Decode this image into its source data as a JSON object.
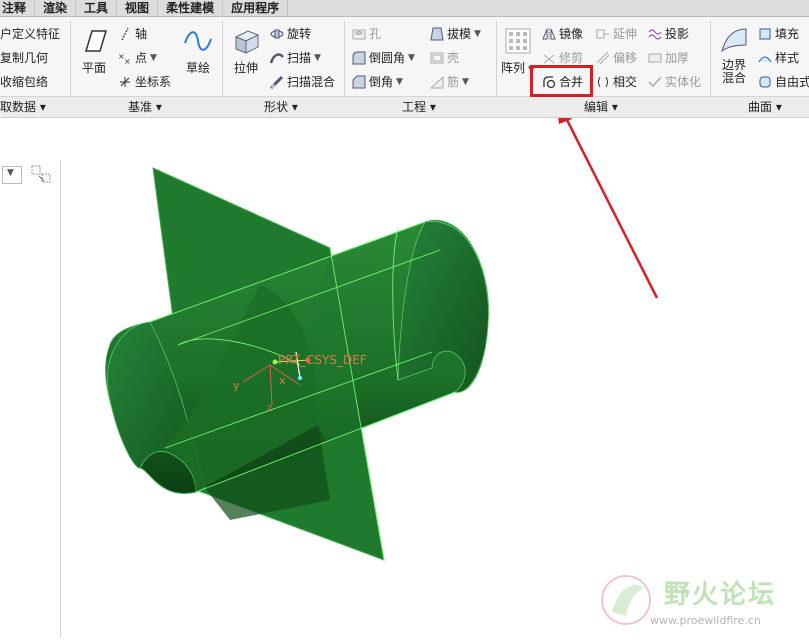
{
  "tabs": [
    "注释",
    "渲染",
    "工具",
    "视图",
    "柔性建模",
    "应用程序"
  ],
  "groups": {
    "get_data": {
      "label": "取数据",
      "items": [
        "户定义特征",
        "复制几何",
        "收缩包络"
      ]
    },
    "datum": {
      "label": "基准",
      "plane": "平面",
      "axis": "轴",
      "point": "点",
      "csys": "坐标系",
      "sketch": "草绘"
    },
    "shapes": {
      "label": "形状",
      "extrude": "拉伸",
      "revolve": "旋转",
      "sweep": "扫描",
      "swept_blend": "扫描混合"
    },
    "engineering": {
      "label": "工程",
      "hole": "孔",
      "round": "倒圆角",
      "chamfer": "倒角",
      "draft": "拔模",
      "shell": "壳",
      "rib": "筋"
    },
    "editing": {
      "label": "编辑",
      "pattern": "阵列",
      "mirror": "镜像",
      "trim": "修剪",
      "merge": "合并",
      "extend": "延伸",
      "offset": "偏移",
      "intersect": "相交",
      "project": "投影",
      "thicken": "加厚",
      "solidify": "实体化"
    },
    "surfaces": {
      "label": "曲面",
      "boundary_blend_line1": "边界",
      "boundary_blend_line2": "混合",
      "fill": "填充",
      "style": "样式",
      "freestyle": "自由式"
    }
  },
  "viewport": {
    "csys_label": "PRT_CSYS_DEF",
    "axis_x": "x",
    "axis_y": "y",
    "axis_z": "z"
  },
  "watermark": {
    "title": "野火论坛",
    "url": "www.proewildfire.cn"
  },
  "colors": {
    "model_green": "#1e7a2c",
    "highlight_red": "#d81f26",
    "edge_green": "#7cff7c"
  }
}
